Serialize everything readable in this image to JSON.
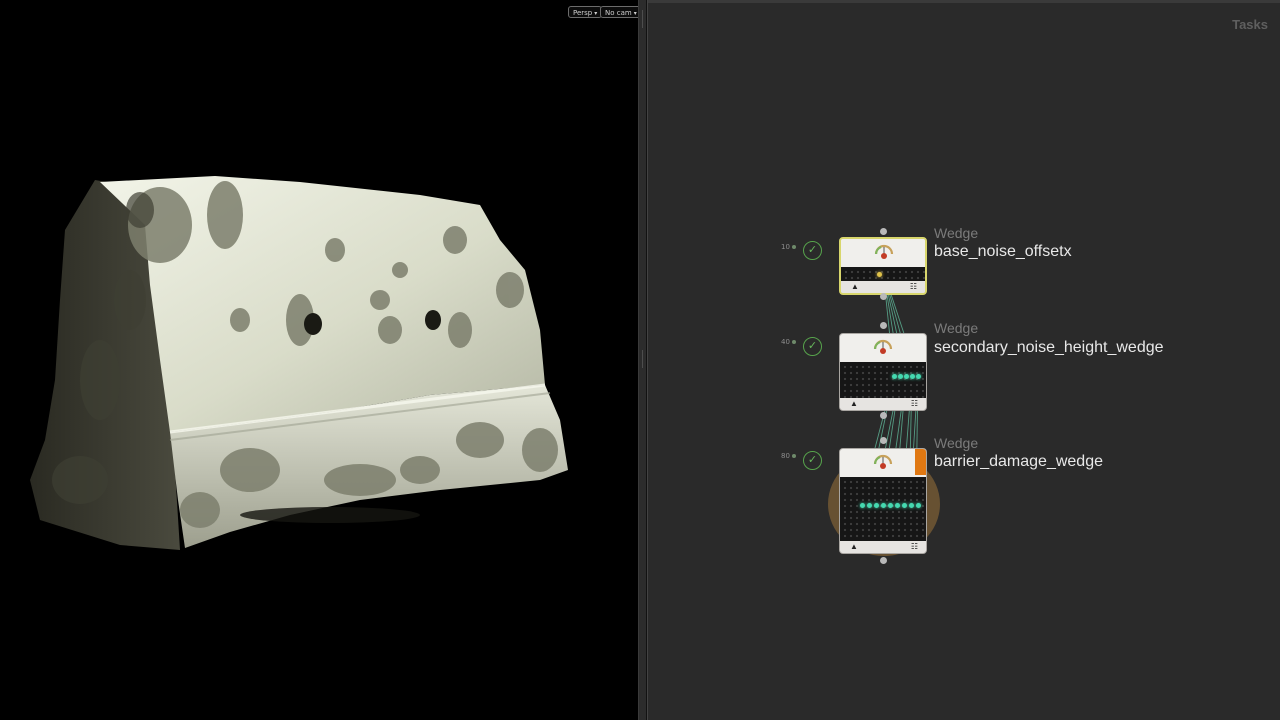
{
  "viewport": {
    "view_menu_label": "Persp",
    "camera_menu_label": "No cam"
  },
  "network": {
    "context_label": "Tasks",
    "nodes": [
      {
        "type": "Wedge",
        "name": "base_noise_offsetx",
        "work_item_count": "10",
        "status": "cooked",
        "selected": true
      },
      {
        "type": "Wedge",
        "name": "secondary_noise_height_wedge",
        "work_item_count": "40",
        "status": "cooked",
        "selected": false
      },
      {
        "type": "Wedge",
        "name": "barrier_damage_wedge",
        "work_item_count": "80",
        "status": "cooked",
        "selected": false
      }
    ],
    "colors": {
      "work_item_done": "#45d9b0",
      "selected_outline": "#d8d66c",
      "status_ok": "#57a34c",
      "cook_flag": "#e07812"
    },
    "icons": [
      "gauge-icon",
      "warning-icon",
      "list-icon",
      "checkmark-icon"
    ]
  }
}
